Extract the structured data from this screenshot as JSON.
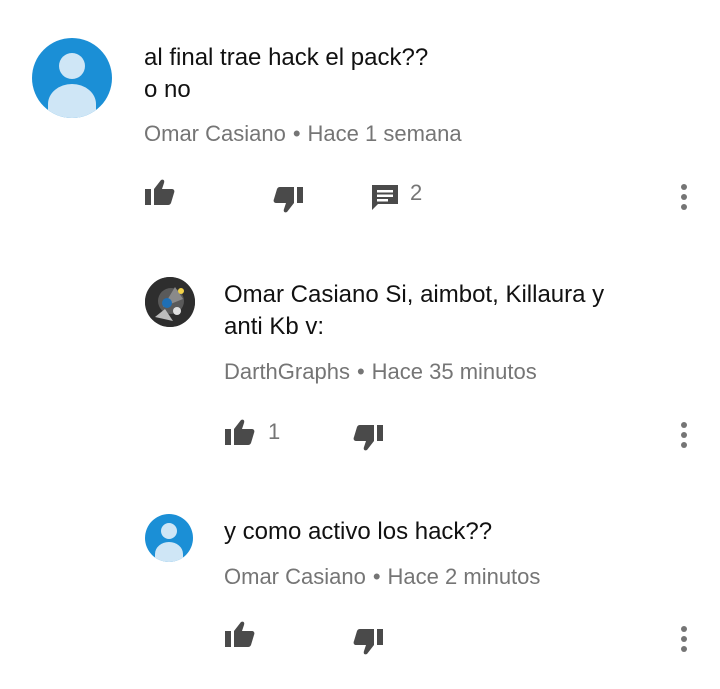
{
  "comments": [
    {
      "text_line1": "al final trae hack el pack??",
      "text_line2": "o no",
      "author": "Omar Casiano",
      "separator": "•",
      "time": "Hace 1 semana",
      "reply_count": "2"
    },
    {
      "text_line1": "Omar Casiano Si, aimbot, Killaura y",
      "text_line2": "anti Kb v:",
      "author": "DarthGraphs",
      "separator": "•",
      "time": "Hace 35 minutos",
      "like_count": "1"
    },
    {
      "text_line1": "y como activo los hack??",
      "author": "Omar Casiano",
      "separator": "•",
      "time": "Hace 2 minutos"
    }
  ],
  "icons": {
    "like": "thumb-up-icon",
    "dislike": "thumb-down-icon",
    "reply": "comment-icon",
    "menu": "more-vert-icon"
  },
  "colors": {
    "avatar_blue": "#1b8fd6",
    "secondary_text": "#757575",
    "icon": "#4a4a4a"
  }
}
